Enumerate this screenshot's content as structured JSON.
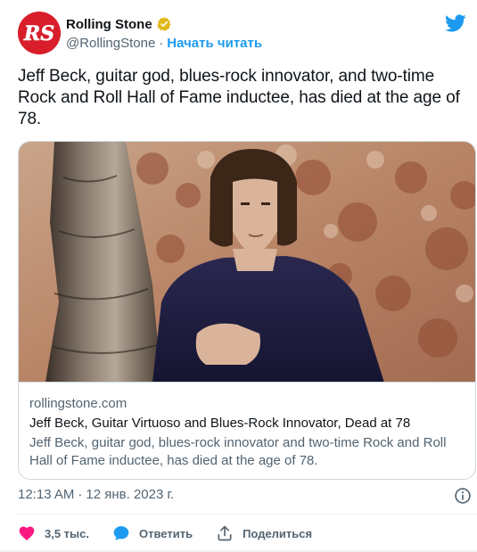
{
  "author": {
    "display_name": "Rolling Stone",
    "handle": "@RollingStone",
    "separator": "·",
    "follow_label": "Начать читать",
    "avatar_text": "RS"
  },
  "tweet": {
    "text": "Jeff Beck, guitar god, blues-rock innovator, and two-time Rock and Roll Hall of Fame inductee, has died at the age of 78."
  },
  "card": {
    "domain": "rollingstone.com",
    "title": "Jeff Beck, Guitar Virtuoso and Blues-Rock Innovator, Dead at 78",
    "description": "Jeff Beck, guitar god, blues-rock innovator and two-time Rock and Roll Hall of Fame inductee, has died at the age of 78."
  },
  "meta": {
    "time": "12:13 AM",
    "separator": "·",
    "date": "12 янв. 2023 г."
  },
  "actions": {
    "like_count": "3,5 тыс.",
    "reply_label": "Ответить",
    "share_label": "Поделиться"
  },
  "colors": {
    "accent": "#1d9bf0",
    "like": "#f91880",
    "brand_red": "#d81e2a",
    "verified_gold": "#e2b719"
  },
  "icons": {
    "verified": "verified-badge-icon",
    "bird": "twitter-bird-icon",
    "info": "info-icon",
    "like": "heart-icon",
    "reply": "speech-bubble-icon",
    "share": "share-icon"
  }
}
